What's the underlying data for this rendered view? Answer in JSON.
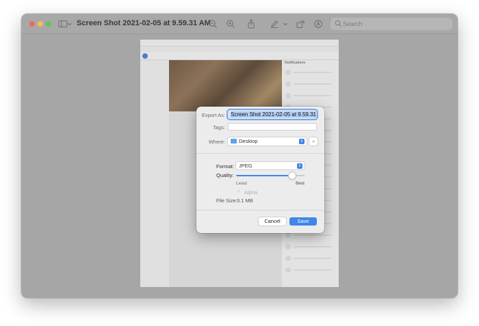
{
  "window": {
    "title": "Screen Shot 2021-02-05 at 9.59.31 AM",
    "search_placeholder": "Search"
  },
  "background_doc": {
    "notifications_title": "Notifications"
  },
  "dialog": {
    "export_as_label": "Export As:",
    "export_as_value": "Screen Shot 2021-02-05 at 9.59.31",
    "tags_label": "Tags:",
    "where_label": "Where:",
    "where_value": "Desktop",
    "format_label": "Format:",
    "format_value": "JPEG",
    "quality_label": "Quality:",
    "quality_level": 0.82,
    "quality_min_label": "Least",
    "quality_max_label": "Best",
    "alpha_label": "Alpha",
    "file_size_label": "File Size:",
    "file_size_value": "3.1 MB",
    "cancel_label": "Cancel",
    "save_label": "Save"
  },
  "colors": {
    "accent": "#3f86e8",
    "close": "#ed6a5e",
    "minimize": "#f5bf4f",
    "maximize": "#61c554"
  },
  "toolbar_icons": [
    "sidebar-icon",
    "zoom-out-icon",
    "zoom-in-icon",
    "share-icon",
    "markup-pen-icon",
    "rotate-icon",
    "annotate-icon"
  ]
}
